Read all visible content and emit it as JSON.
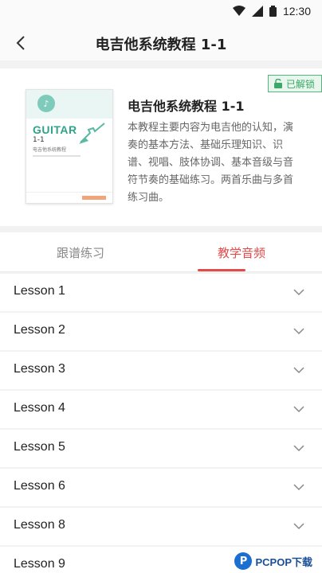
{
  "status_bar": {
    "time": "12:30"
  },
  "header": {
    "title": "电吉他系统教程 1-1"
  },
  "course": {
    "badge": "已解锁",
    "title": "电吉他系统教程 1-1",
    "description": "本教程主要内容为电吉他的认知，演奏的基本方法、基础乐理知识、识谱、视唱、肢体协调、基本音级与音符节奏的基础练习。两首乐曲与多首练习曲。",
    "cover": {
      "brand": "GUITAR",
      "number": "1-1",
      "subtitle": "电吉他系统教程"
    }
  },
  "tabs": [
    {
      "label": "跟谱练习",
      "active": false
    },
    {
      "label": "教学音频",
      "active": true
    }
  ],
  "lessons": [
    {
      "label": "Lesson 1"
    },
    {
      "label": "Lesson 2"
    },
    {
      "label": "Lesson 3"
    },
    {
      "label": "Lesson 4"
    },
    {
      "label": "Lesson 5"
    },
    {
      "label": "Lesson 6"
    },
    {
      "label": "Lesson 8"
    },
    {
      "label": "Lesson 9"
    }
  ],
  "watermark": {
    "text": "PCPOP下载"
  },
  "colors": {
    "accent": "#e04b4b",
    "unlock": "#3aa867"
  }
}
